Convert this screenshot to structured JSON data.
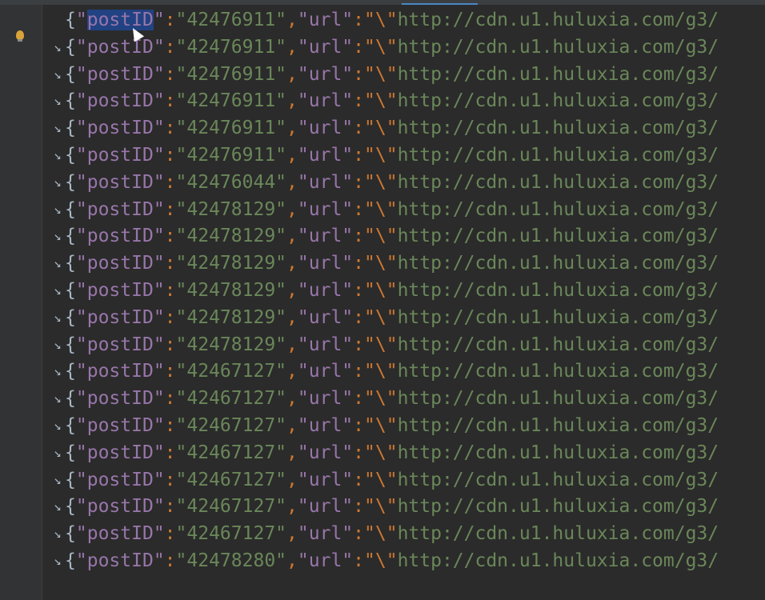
{
  "editor": {
    "brace": "{",
    "key_quote": "\"",
    "post_key": "postID",
    "colon": ":",
    "comma": ",",
    "url_key": "url",
    "url_open": "\"\\\"",
    "url_text": "http://cdn.u1.huluxia.com/g3/",
    "wrap_icon_char": "↘",
    "lines": [
      {
        "post_id": "42476911",
        "wrapped": false
      },
      {
        "post_id": "42476911",
        "wrapped": true
      },
      {
        "post_id": "42476911",
        "wrapped": true
      },
      {
        "post_id": "42476911",
        "wrapped": true
      },
      {
        "post_id": "42476911",
        "wrapped": true
      },
      {
        "post_id": "42476911",
        "wrapped": true
      },
      {
        "post_id": "42476044",
        "wrapped": true
      },
      {
        "post_id": "42478129",
        "wrapped": true
      },
      {
        "post_id": "42478129",
        "wrapped": true
      },
      {
        "post_id": "42478129",
        "wrapped": true
      },
      {
        "post_id": "42478129",
        "wrapped": true
      },
      {
        "post_id": "42478129",
        "wrapped": true
      },
      {
        "post_id": "42478129",
        "wrapped": true
      },
      {
        "post_id": "42467127",
        "wrapped": true
      },
      {
        "post_id": "42467127",
        "wrapped": true
      },
      {
        "post_id": "42467127",
        "wrapped": true
      },
      {
        "post_id": "42467127",
        "wrapped": true
      },
      {
        "post_id": "42467127",
        "wrapped": true
      },
      {
        "post_id": "42467127",
        "wrapped": true
      },
      {
        "post_id": "42467127",
        "wrapped": true
      },
      {
        "post_id": "42478280",
        "wrapped": true
      }
    ]
  },
  "colors": {
    "background": "#2b2b2b",
    "key": "#9876aa",
    "string": "#6a8759",
    "punctuation": "#cc7832",
    "selection": "#214283"
  },
  "icons": [
    "soft-wrap-icon",
    "lightbulb-icon",
    "mouse-cursor-icon"
  ]
}
